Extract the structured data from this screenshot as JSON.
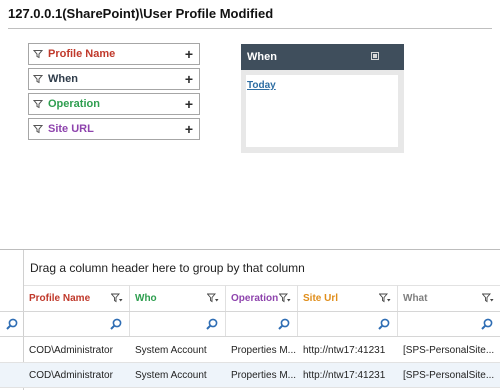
{
  "title": "127.0.0.1(SharePoint)\\User Profile Modified",
  "filters": [
    {
      "label": "Profile Name",
      "color": "#c0392b"
    },
    {
      "label": "When",
      "color": "#2f3c4a"
    },
    {
      "label": "Operation",
      "color": "#2e9e4f"
    },
    {
      "label": "Site URL",
      "color": "#8e44ad"
    }
  ],
  "filter_add_glyph": "+",
  "when_panel": {
    "title": "When",
    "link": "Today"
  },
  "grid": {
    "group_hint": "Drag a column header here to group by that column",
    "columns": [
      {
        "label": "Profile Name",
        "color": "#c0392b"
      },
      {
        "label": "Who",
        "color": "#2e9e4f"
      },
      {
        "label": "Operation",
        "color": "#8e44ad"
      },
      {
        "label": "Site Url",
        "color": "#e08e1b"
      },
      {
        "label": "What",
        "color": "#7f7f7f"
      }
    ],
    "rows": [
      [
        "COD\\Administrator",
        "System Account",
        "Properties M...",
        "http://ntw17:41231",
        "[SPS-PersonalSite..."
      ],
      [
        "COD\\Administrator",
        "System Account",
        "Properties M...",
        "http://ntw17:41231",
        "[SPS-PersonalSite..."
      ]
    ]
  },
  "icons": {
    "filter": "funnel-icon",
    "add": "plus-icon",
    "search": "magnifier-icon",
    "close": "close-icon"
  },
  "colors": {
    "panel_header": "#3f4e5c",
    "link": "#2e6ea3",
    "search_icon": "#2e6db4",
    "alt_row": "#eef4fa"
  }
}
